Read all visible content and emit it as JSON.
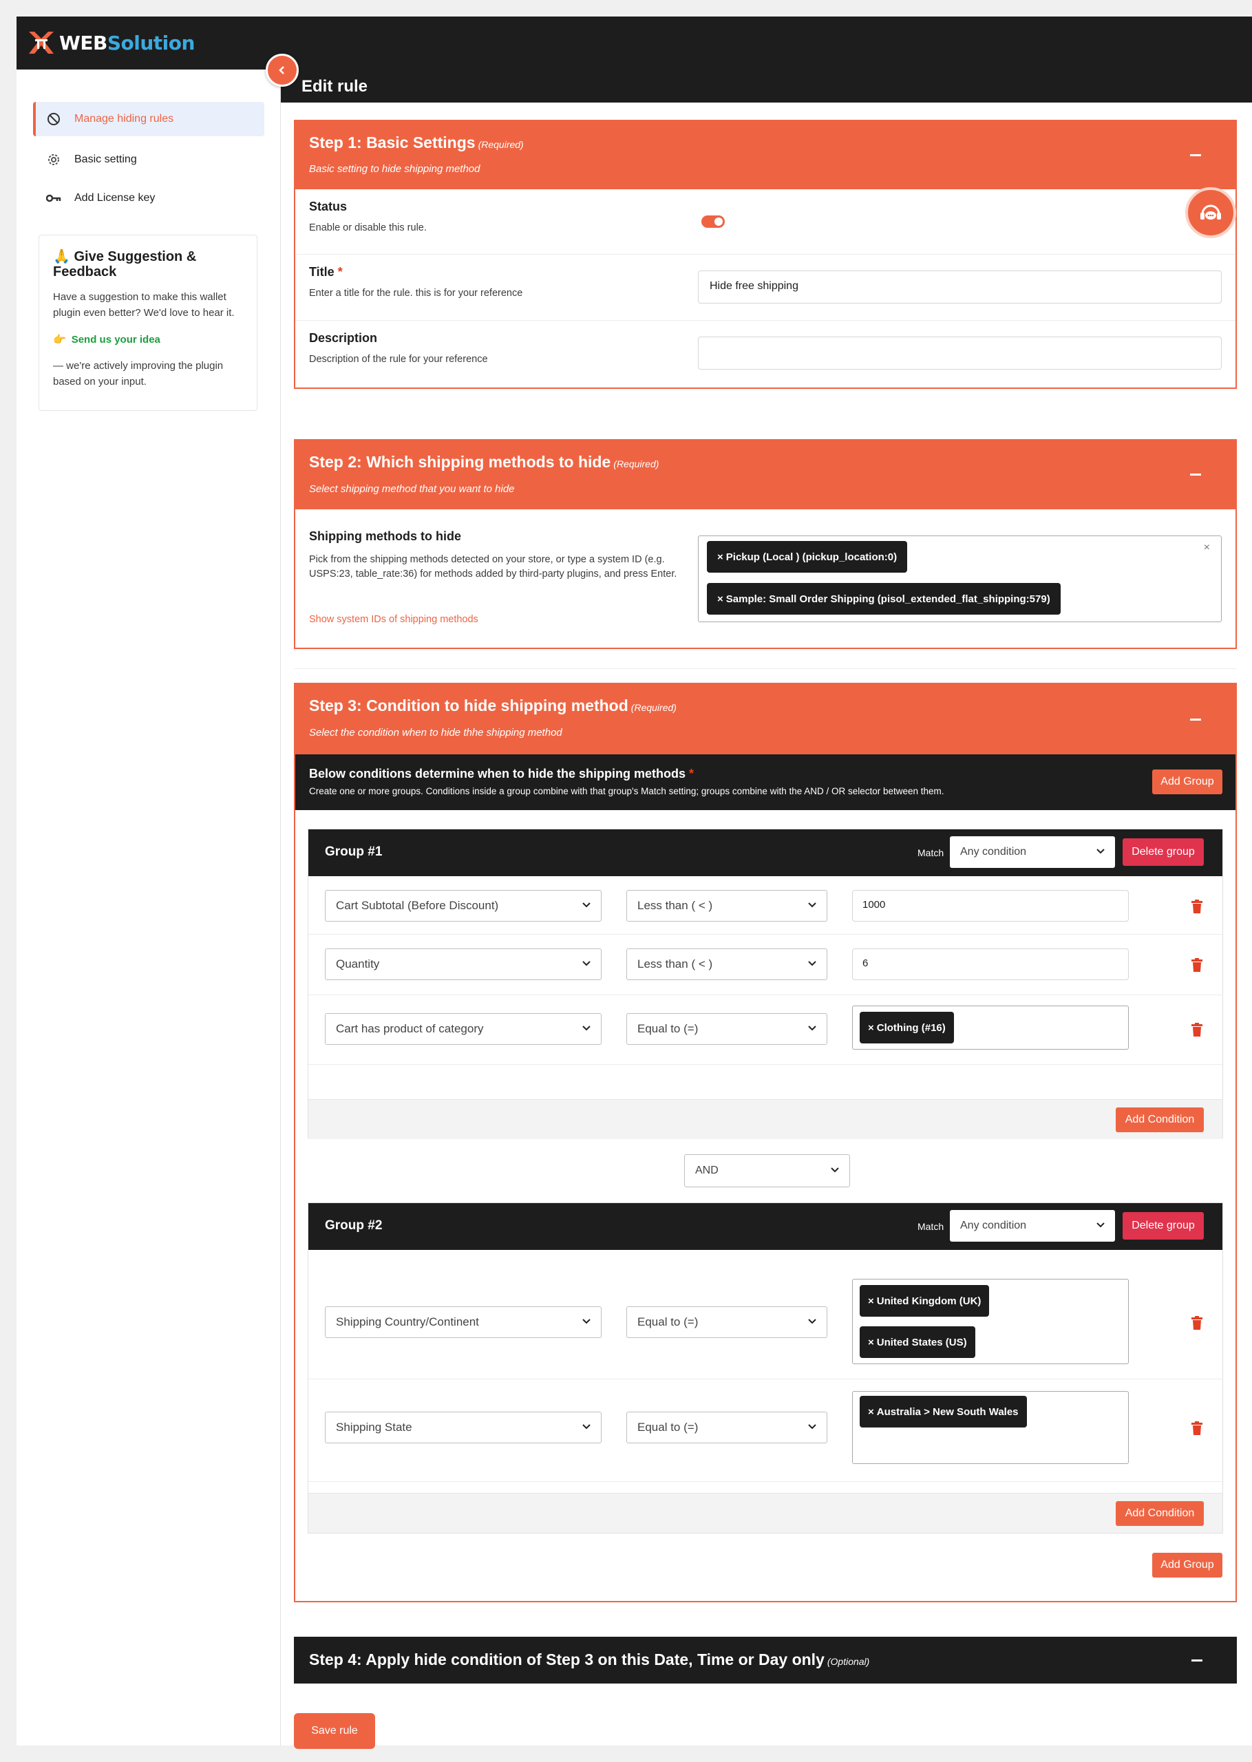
{
  "brand": {
    "web": "WEB",
    "solution": "Solution"
  },
  "sidebar": {
    "items": [
      {
        "label": "Manage hiding rules",
        "icon": "ban-icon"
      },
      {
        "label": "Basic setting",
        "icon": "gear-icon"
      },
      {
        "label": "Add License key",
        "icon": "key-icon"
      }
    ],
    "feedback": {
      "emoji": "🙏",
      "title": "Give Suggestion & Feedback",
      "text": "Have a suggestion to make this wallet plugin even better? We'd love to hear it.",
      "link_emoji": "👉",
      "link": "Send us your idea",
      "tail": "— we're actively improving the plugin based on your input."
    }
  },
  "page": {
    "title": "Edit rule"
  },
  "step1": {
    "title": "Step 1: Basic Settings",
    "required": "(Required)",
    "subtitle": "Basic setting to hide shipping method",
    "status_label": "Status",
    "status_desc": "Enable or disable this rule.",
    "status_enabled": true,
    "title_label": "Title",
    "title_star": "*",
    "title_desc": "Enter a title for the rule. this is for your reference",
    "title_value": "Hide free shipping",
    "desc_label": "Description",
    "desc_desc": "Description of the rule for your reference",
    "desc_value": ""
  },
  "step2": {
    "title": "Step 2: Which shipping methods to hide",
    "required": "(Required)",
    "subtitle": "Select shipping method that you want to hide",
    "label": "Shipping methods to hide",
    "desc": "Pick from the shipping methods detected on your store, or type a system ID (e.g. USPS:23, table_rate:36) for methods added by third-party plugins, and press Enter.",
    "link": "Show system IDs of shipping methods",
    "chips": [
      "Pickup (Local ) (pickup_location:0)",
      "Sample: Small Order Shipping (pisol_extended_flat_shipping:579)"
    ],
    "clear": "×"
  },
  "step3": {
    "title": "Step 3: Condition to hide shipping method",
    "required": "(Required)",
    "subtitle": "Select the condition when to hide thhe shipping method",
    "cond_title": "Below conditions determine when to hide the shipping methods",
    "cond_star": "*",
    "cond_desc": "Create one or more groups. Conditions inside a group combine with that group's Match setting; groups combine with the AND / OR selector between them.",
    "add_group": "Add Group",
    "match_label": "Match",
    "delete_group": "Delete group",
    "add_condition": "Add Condition",
    "connector": "AND",
    "groups": [
      {
        "title": "Group #1",
        "match": "Any condition",
        "conditions": [
          {
            "field": "Cart Subtotal (Before Discount)",
            "operator": "Less than ( < )",
            "value": "1000"
          },
          {
            "field": "Quantity",
            "operator": "Less than ( < )",
            "value": "6"
          },
          {
            "field": "Cart has product of category",
            "operator": "Equal to (=)",
            "chips": [
              "Clothing (#16)"
            ]
          }
        ]
      },
      {
        "title": "Group #2",
        "match": "Any condition",
        "conditions": [
          {
            "field": "Shipping Country/Continent",
            "operator": "Equal to (=)",
            "chips": [
              "United Kingdom (UK)",
              "United States (US)"
            ]
          },
          {
            "field": "Shipping State",
            "operator": "Equal to (=)",
            "chips": [
              "Australia > New South Wales"
            ]
          }
        ]
      }
    ]
  },
  "step4": {
    "title": "Step 4: Apply hide condition of Step 3 on this Date, Time or Day only",
    "optional": "(Optional)"
  },
  "save_label": "Save rule",
  "colors": {
    "accent": "#ee6443",
    "dark": "#1d1d1d",
    "danger": "#e0334d",
    "link_green": "#1b9e3e",
    "brand_blue": "#3ba9df"
  }
}
